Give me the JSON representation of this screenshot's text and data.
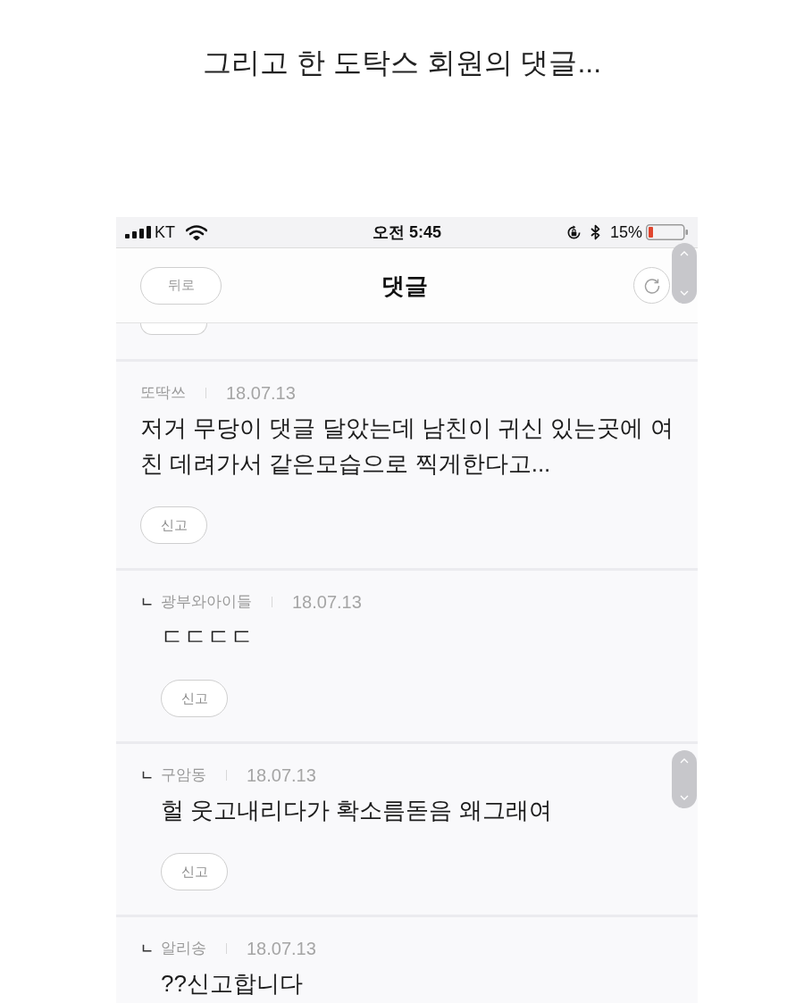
{
  "caption": "그리고 한 도탁스 회원의 댓글...",
  "status_bar": {
    "carrier": "KT",
    "time": "오전 5:45",
    "battery": "15%"
  },
  "header": {
    "back_button": "뒤로",
    "title": "댓글"
  },
  "comments": [
    {
      "author": "또딱쓰",
      "date": "18.07.13",
      "text": "저거 무당이 댓글 달았는데 남친이 귀신 있는곳에 여친 데려가서 같은모습으로 찍게한다고...",
      "report_button": "신고",
      "children": [
        {
          "marker": "ㄴ",
          "author": "광부와아이들",
          "date": "18.07.13",
          "text": "ㄷㄷㄷㄷ",
          "report_button": "신고"
        },
        {
          "marker": "ㄴ",
          "author": "구암동",
          "date": "18.07.13",
          "text": "헐 웃고내리다가 확소름돋음 왜그래여",
          "report_button": "신고"
        },
        {
          "marker": "ㄴ",
          "author": "알리송",
          "date": "18.07.13",
          "text": "??신고합니다"
        }
      ]
    }
  ]
}
